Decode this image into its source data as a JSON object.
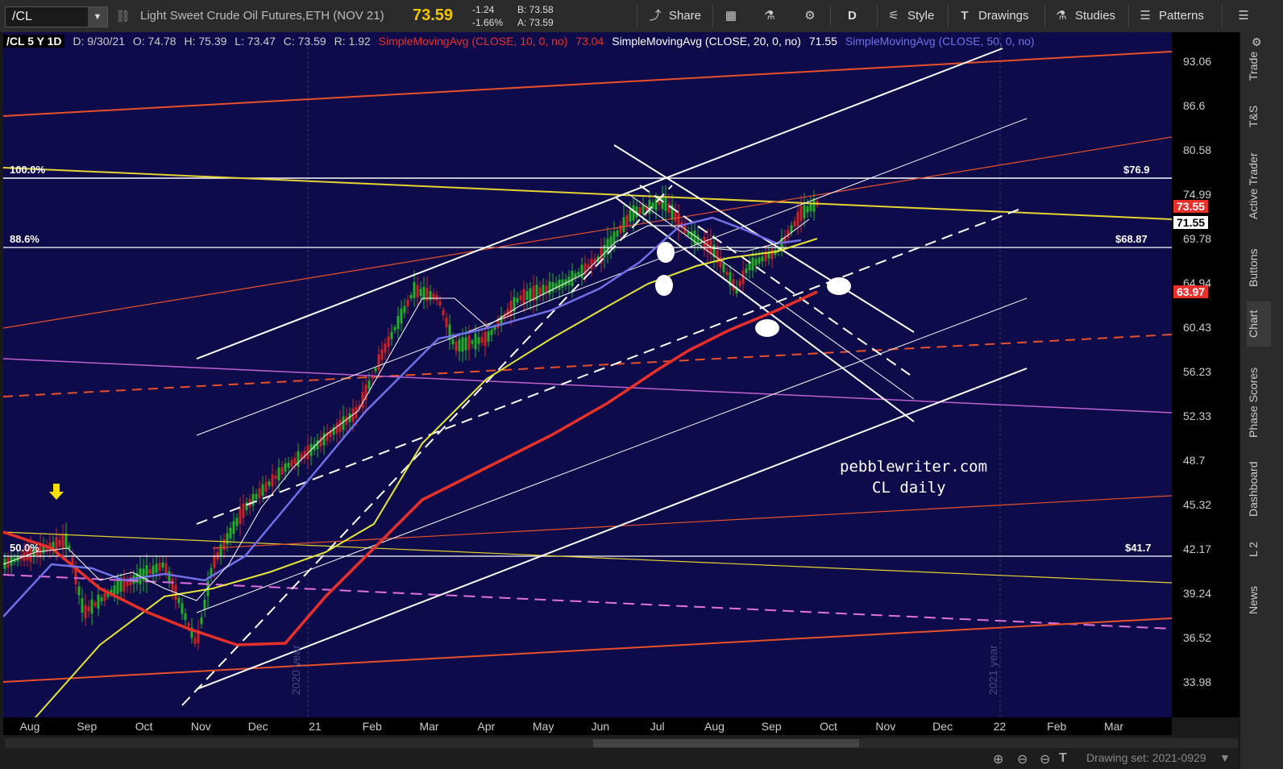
{
  "toolbar": {
    "symbol": "/CL",
    "description": "Light Sweet Crude Oil Futures,ETH (NOV 21)",
    "last": "73.59",
    "change": "-1.24",
    "change_pct": "-1.66%",
    "bid": "B: 73.58",
    "ask": "A: 73.59",
    "share": "Share",
    "period": "D",
    "style": "Style",
    "drawings": "Drawings",
    "studies": "Studies",
    "patterns": "Patterns"
  },
  "info": {
    "symbol": "/CL 5 Y 1D",
    "date": "D: 9/30/21",
    "open": "O: 74.78",
    "high": "H: 75.39",
    "low": "L: 73.47",
    "close": "C: 73.59",
    "range": "R: 1.92",
    "sma10_label": "SimpleMovingAvg (CLOSE, 10, 0, no)",
    "sma10_value": "73.04",
    "sma20_label": "SimpleMovingAvg (CLOSE, 20, 0, no)",
    "sma20_value": "71.55",
    "sma50_label": "SimpleMovingAvg (CLOSE, 50, 0, no)"
  },
  "chart_data": {
    "type": "candlestick",
    "y_ticks": [
      "93.06",
      "86.6",
      "80.58",
      "74.99",
      "69.78",
      "64.94",
      "60.43",
      "56.23",
      "52.33",
      "48.7",
      "45.32",
      "42.17",
      "39.24",
      "36.52",
      "33.98"
    ],
    "x_ticks": [
      "Aug",
      "Sep",
      "Oct",
      "Nov",
      "Dec",
      "21",
      "Feb",
      "Mar",
      "Apr",
      "May",
      "Jun",
      "Jul",
      "Aug",
      "Sep",
      "Oct",
      "Nov",
      "Dec",
      "22",
      "Feb",
      "Mar"
    ],
    "price_badges": [
      {
        "value": "73.55",
        "color": "#e8302a"
      },
      {
        "value": "71.55",
        "color": "#ffffff"
      },
      {
        "value": "63.97",
        "color": "#e8302a"
      }
    ],
    "fib_levels": [
      {
        "pct": "100.0%",
        "price": "$76.9"
      },
      {
        "pct": "88.6%",
        "price": "$68.87"
      },
      {
        "pct": "50.0%",
        "price": "$41.7"
      }
    ],
    "year_marks": [
      "2020 year",
      "2021 year"
    ],
    "watermark_1": "pebblewriter.com",
    "watermark_2": "CL daily"
  },
  "bottombar": {
    "drawing_set": "Drawing set: 2021-0929"
  },
  "right_tabs": [
    "Trade",
    "T&S",
    "Active Trader",
    "Buttons",
    "Chart",
    "Phase Scores",
    "Dashboard",
    "L 2",
    "News"
  ]
}
